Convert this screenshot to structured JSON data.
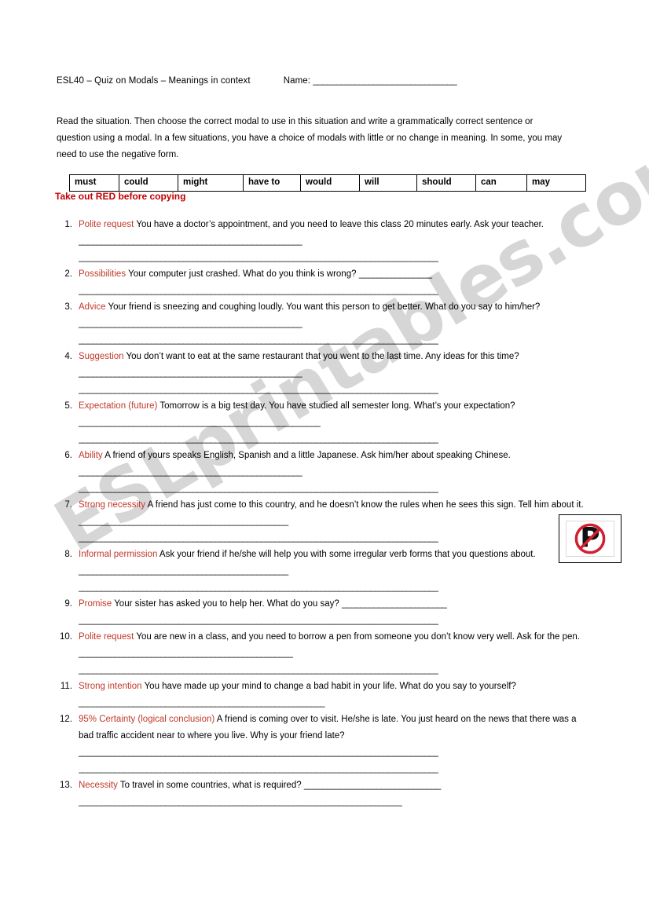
{
  "header": {
    "title": "ESL40 – Quiz on Modals – Meanings in context",
    "name_label": "Name:",
    "name_blank": "_______________________________"
  },
  "instructions": {
    "text": "Read the situation. Then choose the correct modal to use in this situation and write a grammatically correct sentence or question using a modal. In a few situations, you have a choice of modals with little or no change in meaning. In some, you may need to use the negative form."
  },
  "modal_table": {
    "cells": [
      "must",
      "could",
      "might",
      "have to",
      "would",
      "will",
      "should",
      "can",
      "may"
    ]
  },
  "red_note": {
    "text": "Take out RED before copying",
    "color": "#c00000"
  },
  "label_color": "#c0392b",
  "watermark": {
    "text": "ESLprintables.com",
    "color": "#c9c9c9"
  },
  "sign": {
    "name": "no-parking-sign",
    "letter": "P",
    "ring_color": "#d02030"
  },
  "questions": [
    {
      "num": "1.",
      "label": "Polite request",
      "text": "You have a doctor’s appointment, and you need to leave this class 20 minutes early. Ask your teacher. ",
      "inline_blank": "_________________________________________________",
      "blank_lines": [
        "_______________________________________________________________________________"
      ]
    },
    {
      "num": "2.",
      "label": "Possibilities",
      "text": "Your computer just crashed. What do you think is wrong? ",
      "inline_blank": "________________",
      "blank_lines": [
        "_______________________________________________________________________________"
      ]
    },
    {
      "num": "3.",
      "label": "Advice",
      "text": "Your friend is sneezing and coughing loudly. You want this person to get better. What do you say to him/her? ",
      "inline_blank": "_________________________________________________",
      "blank_lines": [
        "_______________________________________________________________________________"
      ]
    },
    {
      "num": "4.",
      "label": "Suggestion",
      "text": "You don’t want to eat at the same restaurant that you went to the last time. Any ideas for this time?",
      "inline_blank": "_________________________________________________",
      "blank_lines": [
        "_______________________________________________________________________________"
      ]
    },
    {
      "num": "5.",
      "label": "Expectation (future)",
      "text": "Tomorrow is a big test day. You have studied all semester long. What’s your expectation?",
      "inline_blank": "_____________________________________________________",
      "blank_lines": [
        "_______________________________________________________________________________"
      ]
    },
    {
      "num": "6.",
      "label": "Ability",
      "text": "A friend of yours speaks English, Spanish and a little Japanese. Ask him/her about speaking Chinese. ",
      "inline_blank": "_________________________________________________",
      "blank_lines": [
        "_______________________________________________________________________________"
      ]
    },
    {
      "num": "7.",
      "label": "Strong necessity",
      "text": "A friend has just come to this country, and he doesn’t know the rules when he sees this sign. Tell him about it. ",
      "inline_blank": "______________________________________________",
      "blank_lines": [
        "_______________________________________________________________________________"
      ]
    },
    {
      "num": "8.",
      "label": "Informal permission",
      "text": "Ask your friend if he/she will help you with some irregular verb forms that you questions about. ",
      "inline_blank": "______________________________________________",
      "blank_lines": [
        "_______________________________________________________________________________"
      ]
    },
    {
      "num": "9.",
      "label": "Promise",
      "text": "Your sister has asked you to help her. What do you say? ",
      "inline_blank": "_______________________",
      "blank_lines": [
        "_______________________________________________________________________________"
      ]
    },
    {
      "num": "10.",
      "label": "Polite request",
      "text": "You are new in a class, and you need to borrow a pen from someone you don’t know very well. Ask for the pen. ",
      "inline_blank": "_______________________________________________",
      "blank_lines": [
        "_______________________________________________________________________________"
      ]
    },
    {
      "num": "11.",
      "label": "Strong intention",
      "text": "You have made up your mind to change a bad habit in your life. What do you say to yourself?",
      "inline_blank": "______________________________________________________",
      "blank_lines": []
    },
    {
      "num": "12.",
      "label": "95% Certainty (logical conclusion)",
      "text": "A friend is coming over to visit. He/she is late. You just heard on the news that there was a bad traffic accident near to where you live. Why is your friend late?",
      "inline_blank": "",
      "blank_lines": [
        "_______________________________________________________________________________",
        "_______________________________________________________________________________"
      ]
    },
    {
      "num": "13.",
      "label": "Necessity",
      "text": "To travel in some countries, what is required? ",
      "inline_blank": "______________________________",
      "blank_lines": [
        "_______________________________________________________________________"
      ]
    }
  ]
}
